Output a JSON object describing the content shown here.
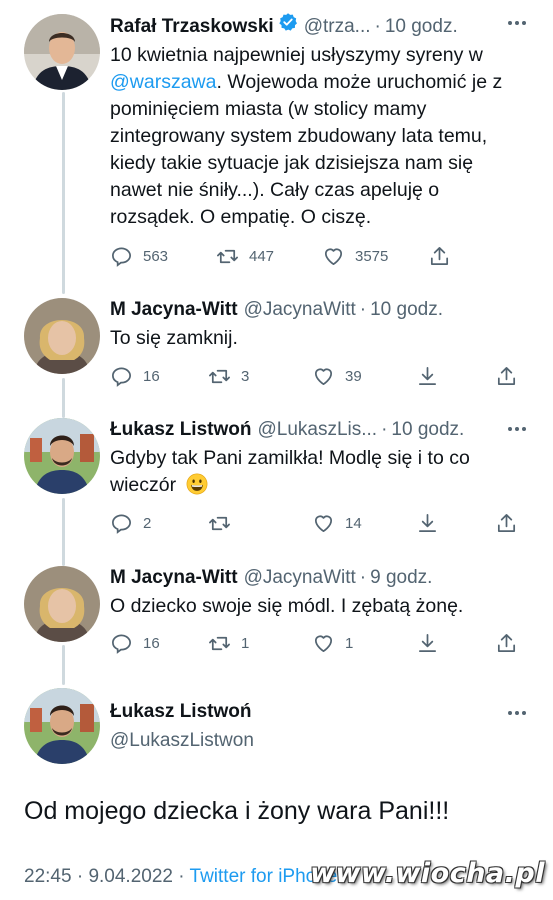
{
  "colors": {
    "accent": "#1d9bf0",
    "secondary_text": "#536471",
    "primary_text": "#0f1419",
    "thread_line": "#cfd9de"
  },
  "tweets": [
    {
      "name": "Rafał Trzaskowski",
      "verified": true,
      "handle": "@trza...",
      "time": "10 godz.",
      "text_part1": "10 kwietnia najpewniej usłyszymy syreny w",
      "mention": "@warszawa",
      "text_part2": ". Wojewoda może uruchomić je z pominięciem miasta (w stolicy mamy zintegrowany system zbudowany lata temu, kiedy takie sytuacje jak dzisiejsza nam się nawet nie śniły...). Cały czas apeluję o rozsądek. O empatię. O ciszę.",
      "replies": "563",
      "retweets": "447",
      "likes": "3575"
    },
    {
      "name": "M Jacyna-Witt",
      "handle": "@JacynaWitt",
      "time": "10 godz.",
      "text": "To się zamknij.",
      "replies": "16",
      "retweets": "3",
      "likes": "39"
    },
    {
      "name": "Łukasz Listwoń",
      "handle": "@LukaszLis...",
      "time": "10 godz.",
      "text": "Gdyby tak Pani zamilkła! Modlę się i to co wieczór",
      "emoji": "grinning-face-emoji",
      "replies": "2",
      "retweets": "",
      "likes": "14"
    },
    {
      "name": "M Jacyna-Witt",
      "handle": "@JacynaWitt",
      "time": "9 godz.",
      "text": "O dziecko swoje się módl. I zębatą żonę.",
      "replies": "16",
      "retweets": "1",
      "likes": "1"
    }
  ],
  "main_tweet": {
    "name": "Łukasz Listwoń",
    "handle": "@LukaszListwon",
    "text": "Od mojego dziecka i żony wara Pani!!!",
    "time": "22:45",
    "date": "9.04.2022",
    "source": "Twitter for iPhone"
  },
  "watermark": "www.wiocha.pl",
  "icons": [
    "reply-icon",
    "retweet-icon",
    "like-icon",
    "share-icon",
    "download-icon",
    "more-icon",
    "verified-icon"
  ]
}
